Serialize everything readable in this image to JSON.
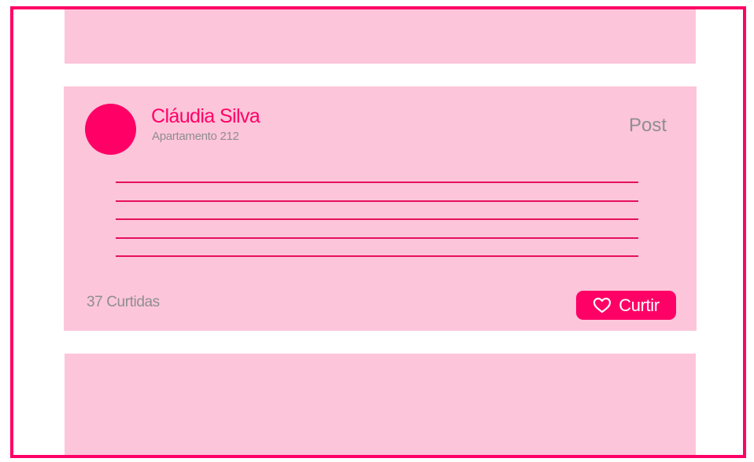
{
  "post": {
    "author_name": "Cláudia Silva",
    "author_unit": "Apartamento 212",
    "type_label": "Post",
    "body_line_count": 5,
    "likes_text": "37 Curtidas",
    "like_button_label": "Curtir"
  },
  "colors": {
    "accent": "#ff0066",
    "card_background": "#fdc5da",
    "muted_text": "#8e8e8e",
    "frame_border": "#ff0066"
  },
  "icons": {
    "like_icon": "heart-outline-icon"
  }
}
